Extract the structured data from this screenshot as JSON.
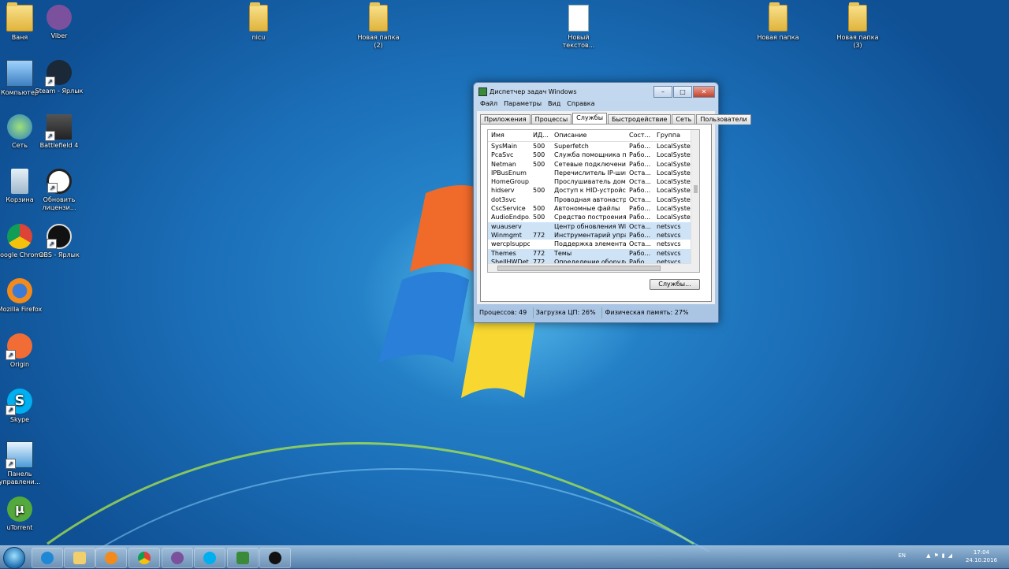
{
  "desktop_icons": [
    {
      "label": "Ваня",
      "type": "folder",
      "x": 0,
      "y": 0
    },
    {
      "label": "Viber",
      "type": "viber"
    },
    {
      "label": "Компьютер"
    },
    {
      "label": "Steam - Ярлык"
    },
    {
      "label": "Сеть"
    },
    {
      "label": "Battlefield 4"
    },
    {
      "label": "Корзина"
    },
    {
      "label": "Обновить лицензи..."
    },
    {
      "label": "Google Chrome"
    },
    {
      "label": "OBS - Ярлык"
    },
    {
      "label": "Mozilla Firefox"
    },
    {
      "label": "Origin"
    },
    {
      "label": "Skype"
    },
    {
      "label": "Панель управлени..."
    },
    {
      "label": "uTorrent"
    },
    {
      "label": "nicu"
    },
    {
      "label": "Новая папка (2)"
    },
    {
      "label": "Новый текстов..."
    },
    {
      "label": "Новая папка"
    },
    {
      "label": "Новая папка (3)"
    }
  ],
  "task_manager": {
    "title": "Диспетчер задач Windows",
    "menu": [
      "Файл",
      "Параметры",
      "Вид",
      "Справка"
    ],
    "tabs": [
      "Приложения",
      "Процессы",
      "Службы",
      "Быстродействие",
      "Сеть",
      "Пользователи"
    ],
    "active_tab": "Службы",
    "columns": [
      "Имя",
      "ИД...",
      "Описание",
      "Сост...",
      "Группа"
    ],
    "rows": [
      {
        "name": "SysMain",
        "pid": "500",
        "desc": "Superfetch",
        "state": "Рабо...",
        "group": "LocalSystemN"
      },
      {
        "name": "PcaSvc",
        "pid": "500",
        "desc": "Служба помощника по ...",
        "state": "Рабо...",
        "group": "LocalSystemN"
      },
      {
        "name": "Netman",
        "pid": "500",
        "desc": "Сетевые подключения",
        "state": "Рабо...",
        "group": "LocalSystemN"
      },
      {
        "name": "IPBusEnum",
        "pid": "",
        "desc": "Перечислитель IP-шин...",
        "state": "Оста...",
        "group": "LocalSystemN"
      },
      {
        "name": "HomeGroup...",
        "pid": "",
        "desc": "Прослушиватель дома...",
        "state": "Оста...",
        "group": "LocalSystemN"
      },
      {
        "name": "hidserv",
        "pid": "500",
        "desc": "Доступ к HID-устройст...",
        "state": "Рабо...",
        "group": "LocalSystemN"
      },
      {
        "name": "dot3svc",
        "pid": "",
        "desc": "Проводная автонастр...",
        "state": "Оста...",
        "group": "LocalSystemN"
      },
      {
        "name": "CscService",
        "pid": "500",
        "desc": "Автономные файлы",
        "state": "Рабо...",
        "group": "LocalSystemN"
      },
      {
        "name": "AudioEndpo...",
        "pid": "500",
        "desc": "Средство построения ...",
        "state": "Рабо...",
        "group": "LocalSystemN"
      },
      {
        "name": "wuauserv",
        "pid": "",
        "desc": "Центр обновления Win...",
        "state": "Оста...",
        "group": "netsvcs"
      },
      {
        "name": "Winmgmt",
        "pid": "772",
        "desc": "Инструментарий управ...",
        "state": "Рабо...",
        "group": "netsvcs"
      },
      {
        "name": "wercplsupport",
        "pid": "",
        "desc": "Поддержка элемента ...",
        "state": "Оста...",
        "group": "netsvcs"
      },
      {
        "name": "Themes",
        "pid": "772",
        "desc": "Темы",
        "state": "Рабо...",
        "group": "netsvcs"
      },
      {
        "name": "ShellHWDet...",
        "pid": "772",
        "desc": "Определение оборудо...",
        "state": "Рабо...",
        "group": "netsvcs"
      }
    ],
    "selected_rows": [
      9,
      10,
      12,
      13
    ],
    "services_button": "Службы...",
    "status": {
      "processes": "Процессов: 49",
      "cpu": "Загрузка ЦП: 26%",
      "memory": "Физическая память: 27%"
    }
  },
  "taskbar": {
    "pinned": [
      "internet-explorer",
      "explorer",
      "media-player",
      "chrome",
      "viber",
      "skype",
      "task-manager",
      "obs"
    ],
    "lang": "EN",
    "time": "17:04",
    "date": "24.10.2016"
  }
}
